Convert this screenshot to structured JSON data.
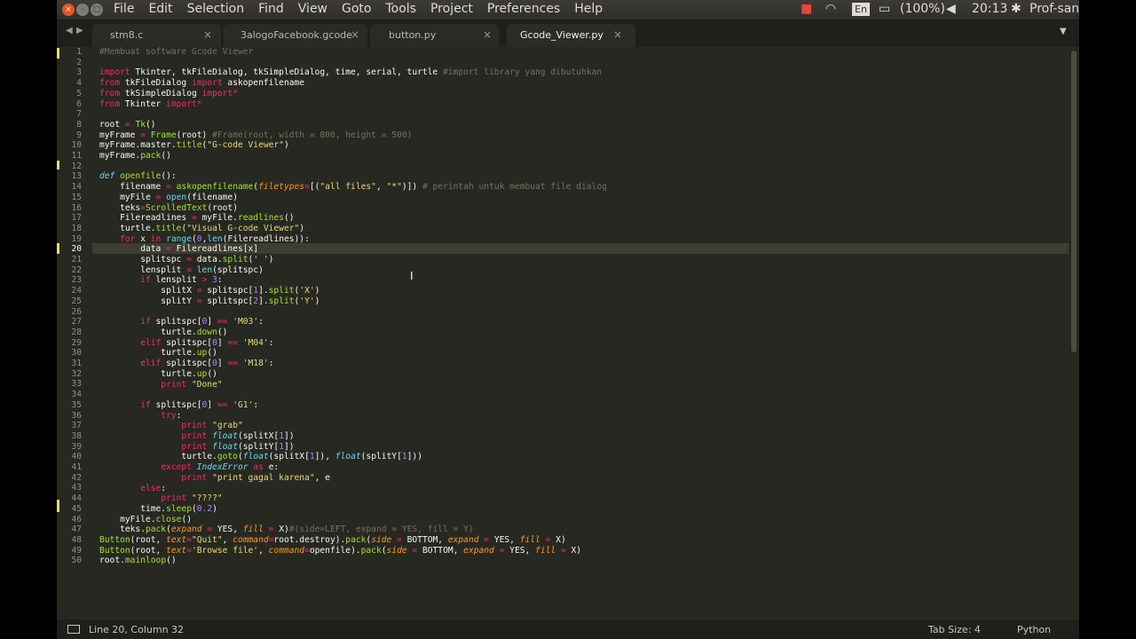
{
  "menubar": {
    "items": [
      "File",
      "Edit",
      "Selection",
      "Find",
      "View",
      "Goto",
      "Tools",
      "Project",
      "Preferences",
      "Help"
    ],
    "indicators": {
      "keyboard": "En",
      "battery": "(100%)",
      "time": "20:13",
      "user": "Prof-san"
    }
  },
  "tabs": [
    {
      "label": "stm8.c",
      "active": false
    },
    {
      "label": "3alogoFacebook.gcode",
      "active": false
    },
    {
      "label": "button.py",
      "active": false
    },
    {
      "label": "Gcode_Viewer.py",
      "active": true
    }
  ],
  "editor": {
    "line_numbers": [
      "1",
      "2",
      "3",
      "4",
      "5",
      "6",
      "7",
      "8",
      "9",
      "10",
      "11",
      "12",
      "13",
      "14",
      "15",
      "16",
      "17",
      "18",
      "19",
      "20",
      "21",
      "22",
      "23",
      "24",
      "25",
      "26",
      "27",
      "28",
      "29",
      "30",
      "31",
      "32",
      "33",
      "34",
      "35",
      "36",
      "37",
      "38",
      "39",
      "40",
      "41",
      "42",
      "43",
      "44",
      "45",
      "46",
      "47",
      "48",
      "49",
      "50"
    ],
    "current_line": 20
  },
  "status": {
    "position": "Line 20, Column 32",
    "tab_size": "Tab Size: 4",
    "syntax": "Python"
  },
  "colors": {
    "editor_bg": "#272822",
    "keyword": "#f92672",
    "string": "#e6db74",
    "comment": "#75715e",
    "function": "#a6e22e",
    "builtin": "#66d9ef"
  }
}
